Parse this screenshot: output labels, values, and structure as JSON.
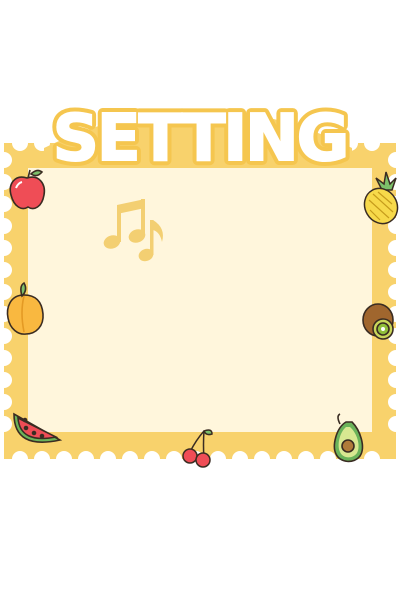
{
  "title": "SETTING",
  "colors": {
    "frame": "#f8d26c",
    "frame_edge": "#f3c24f",
    "panel": "#fff6dc",
    "title_fill": "#ffffff",
    "title_outline": "#f5c64f",
    "music_note": "#f3cf72"
  },
  "icons": {
    "music": "music-note-icon",
    "fruits": [
      "apple-icon",
      "pineapple-icon",
      "peach-icon",
      "kiwi-icon",
      "watermelon-icon",
      "cherry-icon",
      "avocado-icon"
    ]
  }
}
